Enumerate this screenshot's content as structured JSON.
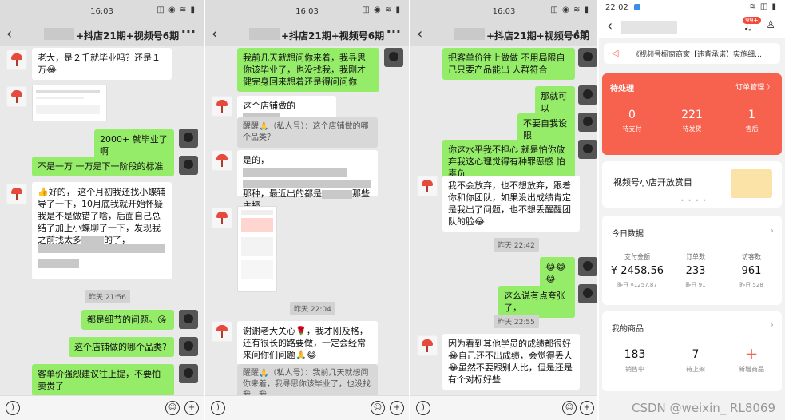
{
  "chat_panels": [
    {
      "status_time": "16:03",
      "title": "+抖店21期+视频号6期",
      "messages": {
        "m1": "老大，是２千就毕业吗？还是１万😂",
        "m2": "2000+ 就毕业了啊",
        "m3": "不是一万 一万是下一阶段的标准",
        "m4": "👍好的，  这个月初我还找小蝶辅导了一下，10月底我就开始怀疑我是不是做错了啥，后面自己总结了加上小蝶聊了一下，发现我之前找太多",
        "m4_tail": "的了，",
        "time": "昨天 21:56",
        "m5": "都是细节的问题。😘",
        "m6": "这个店铺做的哪个品类?",
        "m7": "客单价强烈建议往上提，不要怕卖贵了"
      }
    },
    {
      "status_time": "16:03",
      "title": "+抖店21期+视频号6期",
      "messages": {
        "m1": "我前几天就想问你来着，我寻思你该毕业了，也没找我，我刚才健完身回来想着还是得问问你",
        "m2": "这个店铺做的",
        "m3": "醒醒🙏（私人号）：这个店铺做的哪个品类？",
        "m4a": "是的，",
        "m4b": "那种，最近出的都是",
        "m4c": "那些主播",
        "time": "昨天 22:04",
        "m5": "谢谢老大关心🌹，我才刚及格，还有很长的路要做，一定会经常来问你们问题🙏😂",
        "m6": "醒醒🙏（私人号）：我前几天就想问你来着，我寻思你该毕业了，也没找我，我..."
      }
    },
    {
      "status_time": "16:03",
      "title": "+抖店21期+视频号6期",
      "messages": {
        "m1": "把客单价往上做做 不用局限自己只要产品能出 人群符合",
        "m2": "那就可以",
        "m3": "不要自我设限",
        "m4": "你这水平我不担心 就是怕你放弃我这心理觉得有种罪恶感 怕辜负",
        "m5": "我不会放弃，也不想放弃，跟着你和你团队，如果没出成绩肯定是我出了问题，也不想丢醒醒团队的脸😂",
        "time1": "昨天 22:42",
        "m6": "😂😂😂",
        "m7": "这么说有点夸张了，",
        "time2": "昨天 22:55",
        "m8": "因为看到其他学员的成绩都很好😂自己还不出成绩，会觉得丢人😂虽然不要跟别人比，但是还是有个对标好些"
      }
    }
  ],
  "shop": {
    "status_time": "22:02",
    "badge": "99+",
    "notice": "《视频号橱窗商家【违背承诺】实施细…",
    "pending": {
      "title": "待处理",
      "link": "订单管理 〉",
      "items": [
        {
          "value": "0",
          "label": "待支付"
        },
        {
          "value": "221",
          "label": "待发货"
        },
        {
          "value": "1",
          "label": "售后"
        }
      ]
    },
    "banner": "视频号小店开放赏目",
    "today": {
      "title": "今日数据",
      "items": [
        {
          "label": "支付金额",
          "value": "¥ 2458.56",
          "sub": "昨日 ¥1257.87"
        },
        {
          "label": "订单数",
          "value": "233",
          "sub": "昨日 91"
        },
        {
          "label": "访客数",
          "value": "961",
          "sub": "昨日 528"
        }
      ]
    },
    "goods": {
      "title": "我的商品",
      "items": [
        {
          "value": "183",
          "label": "销售中"
        },
        {
          "value": "7",
          "label": "待上架"
        },
        {
          "value": "+",
          "label": "新增商品"
        }
      ]
    }
  },
  "watermark": "CSDN @weixin_ RL8069",
  "colors": {
    "bubble_green": "#95ec69",
    "accent_red": "#f7624f"
  }
}
